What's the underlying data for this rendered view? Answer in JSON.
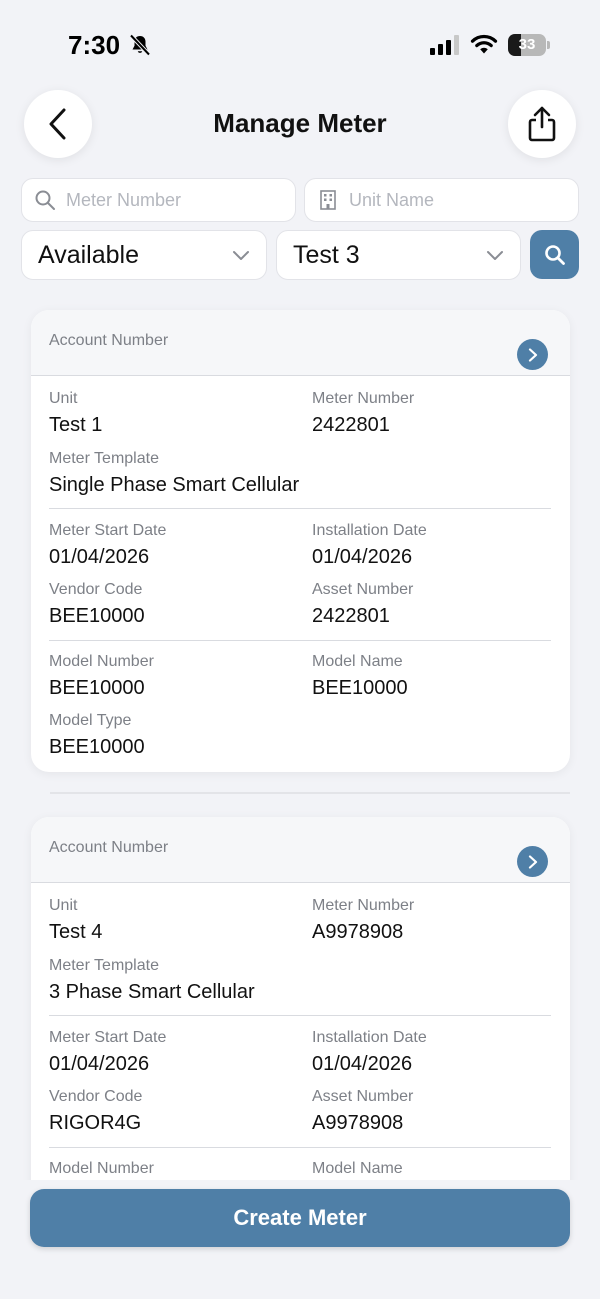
{
  "status_bar": {
    "time": "7:30",
    "battery": "33",
    "battery_level": 0.33
  },
  "header": {
    "title": "Manage Meter"
  },
  "search": {
    "meter_placeholder": "Meter Number",
    "unit_placeholder": "Unit Name",
    "status_value": "Available",
    "unit_value": "Test 3"
  },
  "labels": {
    "account_number": "Account Number",
    "unit": "Unit",
    "meter_number": "Meter Number",
    "meter_template": "Meter Template",
    "meter_start_date": "Meter Start Date",
    "installation_date": "Installation Date",
    "vendor_code": "Vendor Code",
    "asset_number": "Asset Number",
    "model_number": "Model Number",
    "model_name": "Model Name",
    "model_type": "Model Type"
  },
  "meters": [
    {
      "unit": "Test 1",
      "meter_number": "2422801",
      "meter_template": "Single Phase Smart Cellular",
      "meter_start_date": "01/04/2026",
      "installation_date": "01/04/2026",
      "vendor_code": "BEE10000",
      "asset_number": "2422801",
      "model_number": "BEE10000",
      "model_name": "BEE10000",
      "model_type": "BEE10000"
    },
    {
      "unit": "Test 4",
      "meter_number": "A9978908",
      "meter_template": "3 Phase Smart Cellular",
      "meter_start_date": "01/04/2026",
      "installation_date": "01/04/2026",
      "vendor_code": "RIGOR4G",
      "asset_number": "A9978908"
    }
  ],
  "actions": {
    "create_label": "Create Meter"
  },
  "colors": {
    "accent": "#4f7fa7",
    "background": "#f2f3f7"
  },
  "icons": [
    "bell-off-icon",
    "signal-icon",
    "wifi-icon",
    "battery-icon",
    "back-chevron-icon",
    "share-icon",
    "search-icon",
    "building-icon",
    "chevron-down-icon",
    "chevron-right-icon"
  ]
}
